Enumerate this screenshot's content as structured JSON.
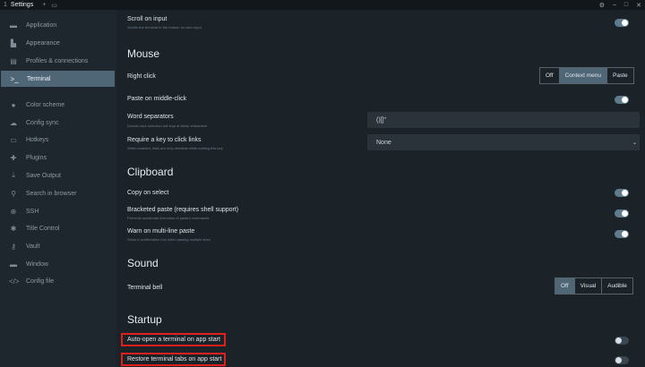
{
  "titlebar": {
    "tab_num": "1",
    "tab_title": "Settings",
    "new_tab": "+",
    "gear": "⚙",
    "minimize": "–",
    "maximize": "□",
    "close": "✕"
  },
  "sidebar": {
    "items": [
      {
        "label": "Application",
        "icon": "window-icon"
      },
      {
        "label": "Appearance",
        "icon": "paint-icon"
      },
      {
        "label": "Profiles & connections",
        "icon": "list-icon"
      },
      {
        "label": "Terminal",
        "icon": "terminal-icon"
      },
      {
        "label": "Color scheme",
        "icon": "palette-icon"
      },
      {
        "label": "Config sync",
        "icon": "cloud-icon"
      },
      {
        "label": "Hotkeys",
        "icon": "keyboard-icon"
      },
      {
        "label": "Plugins",
        "icon": "puzzle-icon"
      },
      {
        "label": "Save Output",
        "icon": "download-icon"
      },
      {
        "label": "Search in browser",
        "icon": "search-icon"
      },
      {
        "label": "SSH",
        "icon": "globe-icon"
      },
      {
        "label": "Title Control",
        "icon": "flag-icon"
      },
      {
        "label": "Vault",
        "icon": "key-icon"
      },
      {
        "label": "Window",
        "icon": "window-icon"
      },
      {
        "label": "Config file",
        "icon": "code-icon"
      }
    ],
    "active": "Terminal"
  },
  "settings": {
    "scroll_on_input": {
      "label": "Scroll on input",
      "sub": "Scrolls the terminal to the bottom on user input",
      "on": true
    },
    "mouse_header": "Mouse",
    "right_click": {
      "label": "Right click",
      "options": [
        "Off",
        "Context menu",
        "Paste"
      ],
      "selected": "Context menu"
    },
    "paste_middle": {
      "label": "Paste on middle-click",
      "on": true
    },
    "word_separators": {
      "label": "Word separators",
      "sub": "Double-click selection will stop at these characters",
      "value": "()[]\""
    },
    "require_key": {
      "label": "Require a key to click links",
      "sub": "When enabled, links are only clickable while holding this key",
      "value": "None"
    },
    "clipboard_header": "Clipboard",
    "copy_on_select": {
      "label": "Copy on select",
      "on": true
    },
    "bracketed_paste": {
      "label": "Bracketed paste (requires shell support)",
      "sub": "Prevents accidental execution of pasted commands",
      "on": true
    },
    "warn_multiline": {
      "label": "Warn on multi-line paste",
      "sub": "Show a confirmation box when pasting multiple lines",
      "on": true
    },
    "sound_header": "Sound",
    "terminal_bell": {
      "label": "Terminal bell",
      "options": [
        "Off",
        "Visual",
        "Audible"
      ],
      "selected": "Off"
    },
    "startup_header": "Startup",
    "auto_open": {
      "label": "Auto-open a terminal on app start",
      "on": false
    },
    "restore_tabs": {
      "label": "Restore terminal tabs on app start",
      "on": false
    }
  },
  "colors": {
    "accent": "#4f6677",
    "highlight": "#e0201e",
    "toggle_on": "#5f7c8e"
  }
}
